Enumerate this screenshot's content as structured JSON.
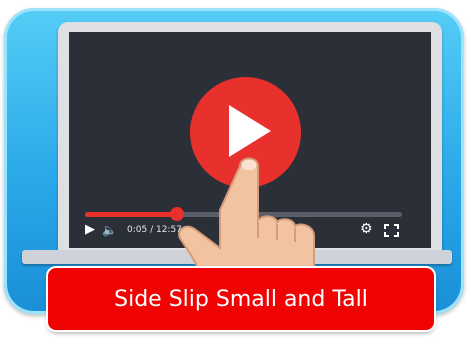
{
  "banner": {
    "title": "Side Slip Small and Tall"
  },
  "player": {
    "time_display": "0:05 / 12:57",
    "progress_fraction": 0.29,
    "icons": {
      "big_play": "play-icon",
      "play": "play-icon",
      "volume": "volume-icon",
      "settings": "gear-icon",
      "fullscreen": "fullscreen-icon",
      "hand": "pointing-hand-icon"
    }
  },
  "colors": {
    "frame": "#2aa9e9",
    "screen": "#2b2f38",
    "accent_red": "#e8302c",
    "banner": "#ef0303",
    "banner_text": "#ffffff"
  }
}
